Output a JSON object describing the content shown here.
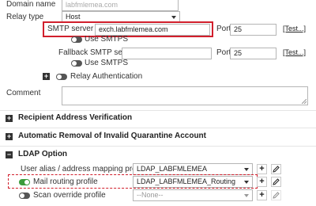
{
  "domain_name": {
    "label": "Domain name",
    "value": "labfmlemea.com"
  },
  "relay_type": {
    "label": "Relay type",
    "value": "Host"
  },
  "smtp_server": {
    "label": "SMTP server",
    "value": "exch.labfmlemea.com",
    "port_label": "Port",
    "port": "25",
    "test": "[Test...]",
    "smtps_label": "Use SMTPS"
  },
  "fallback_smtp": {
    "label": "Fallback SMTP server",
    "value": "",
    "port_label": "Port",
    "port": "25",
    "test": "[Test...]",
    "smtps_label": "Use SMTPS"
  },
  "relay_auth": {
    "label": "Relay Authentication"
  },
  "comment": {
    "label": "Comment",
    "value": ""
  },
  "sections": {
    "recipient": "Recipient Address Verification",
    "auto_removal": "Automatic Removal of Invalid Quarantine Account",
    "ldap": "LDAP Option"
  },
  "ldap": {
    "user_alias": {
      "label": "User alias / address mapping profile",
      "value": "LDAP_LABFMLEMEA"
    },
    "mail_routing": {
      "label": "Mail routing profile",
      "value": "LDAP_LABFMLEMEA_Routing"
    },
    "scan_override": {
      "label": "Scan override profile",
      "value": "--None--"
    }
  },
  "icons": {
    "add": "+",
    "edit": "edit-icon",
    "expand": "+",
    "collapse": "−"
  },
  "colors": {
    "highlight": "#d11f2c",
    "toggle_on": "#3b9b3b",
    "toggle_off": "#555555"
  }
}
